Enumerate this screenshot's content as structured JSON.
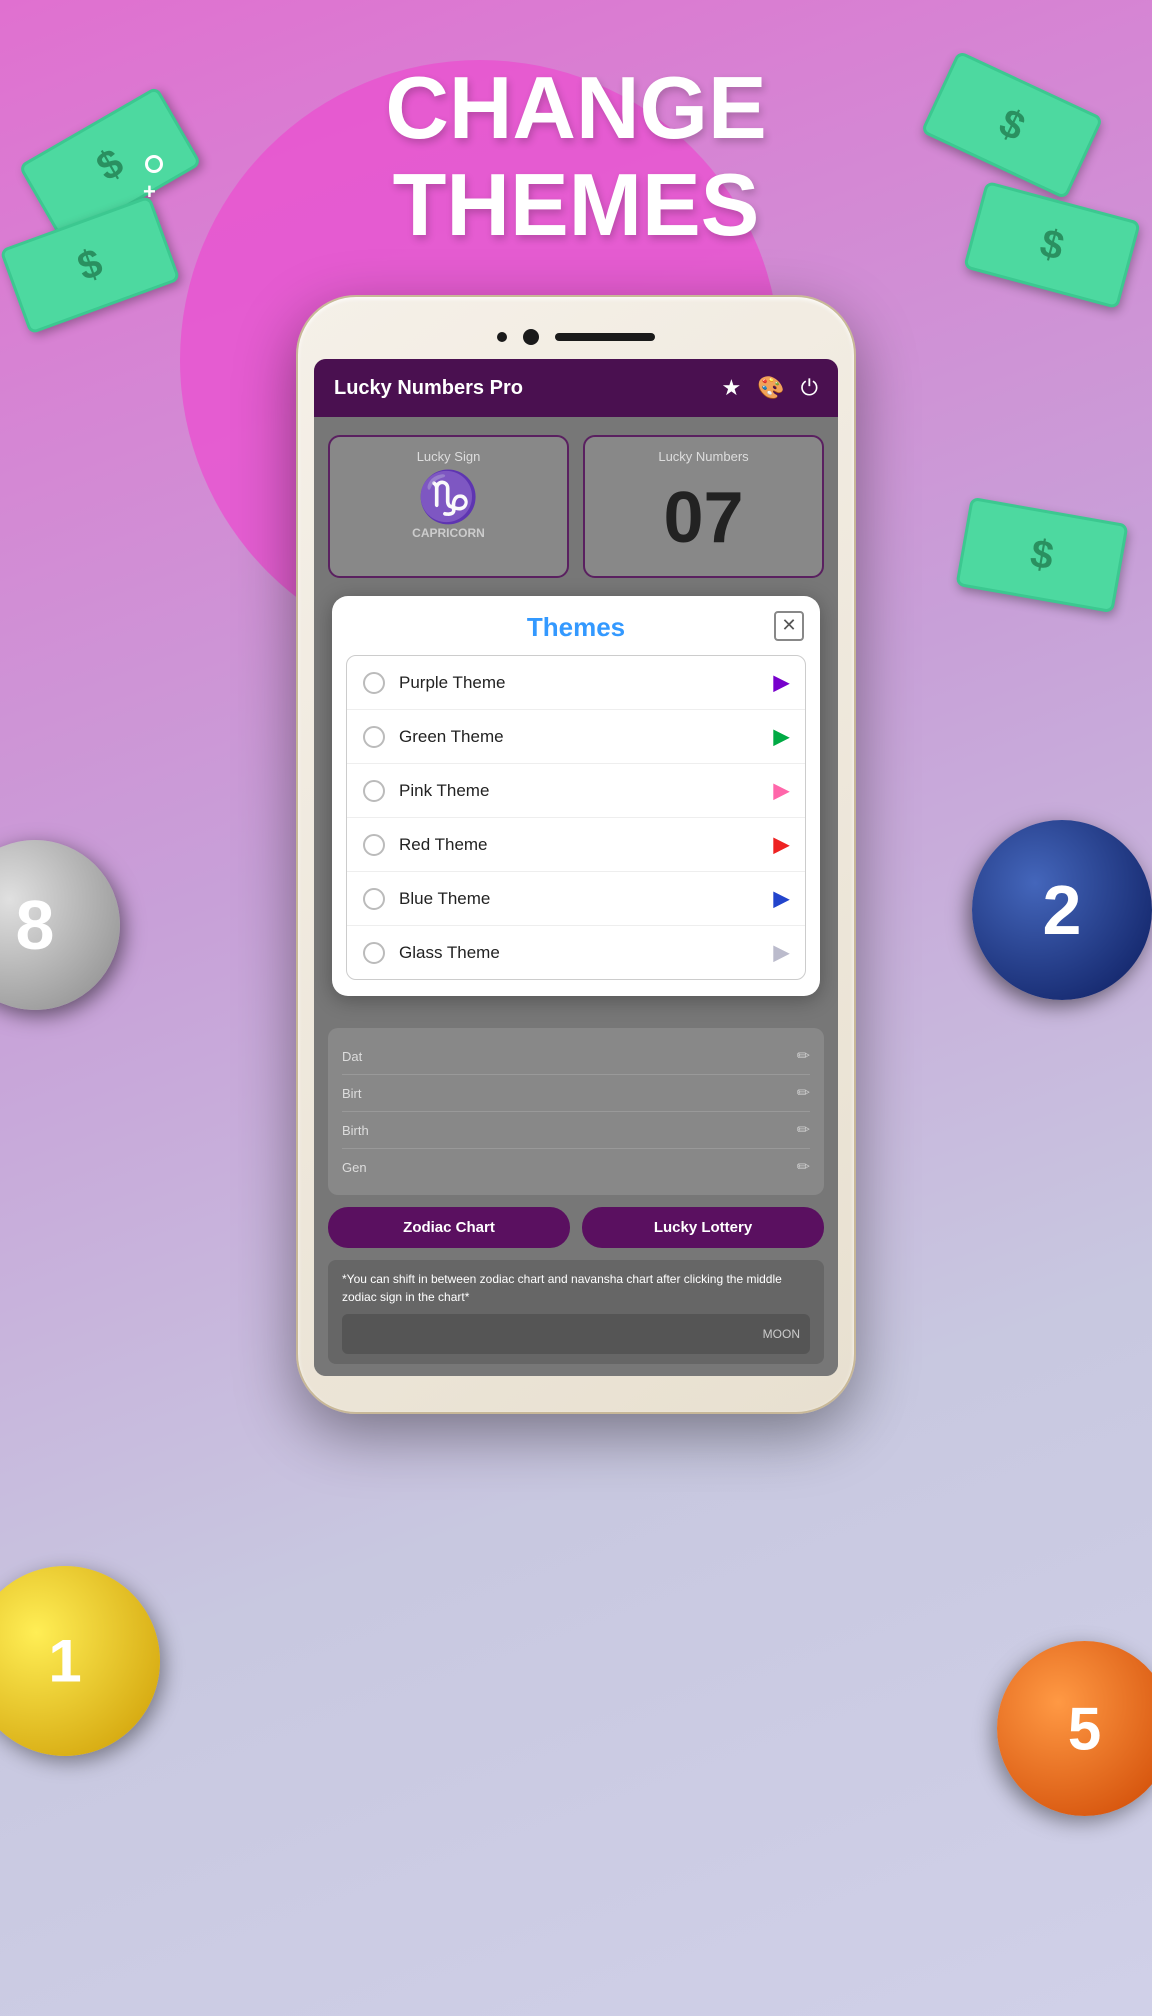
{
  "background": {
    "title_line1": "CHANGE",
    "title_line2": "THEMES"
  },
  "app": {
    "title": "Lucky Numbers Pro",
    "header_icons": {
      "star": "★",
      "palette": "🎨",
      "power": "⏻"
    },
    "lucky_sign": {
      "label": "Lucky Sign",
      "sign": "♑",
      "name": "CAPRICORN"
    },
    "lucky_numbers": {
      "label": "Lucky Numbers",
      "value": "07"
    },
    "themes_dialog": {
      "title": "Themes",
      "close_label": "✕",
      "themes": [
        {
          "name": "Purple Theme",
          "arrow_class": "arrow-purple",
          "arrow": "▶"
        },
        {
          "name": "Green Theme",
          "arrow_class": "arrow-green",
          "arrow": "▶"
        },
        {
          "name": "Pink Theme",
          "arrow_class": "arrow-pink",
          "arrow": "▶"
        },
        {
          "name": "Red Theme",
          "arrow_class": "arrow-red",
          "arrow": "▶"
        },
        {
          "name": "Blue Theme",
          "arrow_class": "arrow-blue",
          "arrow": "▶"
        },
        {
          "name": "Glass Theme",
          "arrow_class": "arrow-glass",
          "arrow": "▶"
        }
      ]
    },
    "info_rows": [
      {
        "label": "Dat",
        "value": ""
      },
      {
        "label": "Birt",
        "value": ""
      },
      {
        "label": "Birth",
        "value": ""
      },
      {
        "label": "Gen",
        "value": ""
      }
    ],
    "buttons": {
      "zodiac": "Zodiac Chart",
      "lottery": "Lucky Lottery"
    },
    "note": "*You can shift in between zodiac chart and navansha chart after clicking the middle zodiac sign in the chart*",
    "moon_label": "MOON"
  },
  "billiard_balls": {
    "dark_blue": "2",
    "grey": "8",
    "yellow": "1",
    "orange": "5"
  }
}
